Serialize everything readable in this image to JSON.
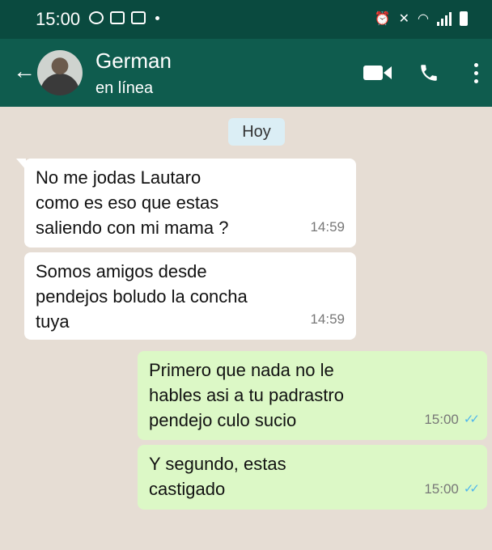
{
  "status_bar": {
    "time": "15:00"
  },
  "header": {
    "name": "German",
    "status": "en línea"
  },
  "chat": {
    "date_chip": "Hoy",
    "messages": [
      {
        "direction": "in",
        "text": "No me jodas Lautaro\ncomo es eso que estas\nsaliendo con mi mama ?",
        "time": "14:59"
      },
      {
        "direction": "in",
        "text": "Somos amigos desde\npendejos boludo la concha\ntuya",
        "time": "14:59"
      },
      {
        "direction": "out",
        "text": "Primero que nada no le\nhables asi a tu padrastro\npendejo culo sucio",
        "time": "15:00"
      },
      {
        "direction": "out",
        "text": "Y segundo, estas\ncastigado",
        "time": "15:00"
      }
    ]
  },
  "icons": {
    "back": "arrow-back-icon",
    "video": "video-call-icon",
    "call": "phone-icon",
    "menu": "more-vert-icon",
    "read": "double-check-icon"
  },
  "colors": {
    "status_bar": "#0a4a3f",
    "header": "#0f5c4e",
    "chat_bg": "#e6ddd4",
    "incoming": "#ffffff",
    "outgoing": "#dcf8c6",
    "read_ticks": "#4fb6ec"
  }
}
